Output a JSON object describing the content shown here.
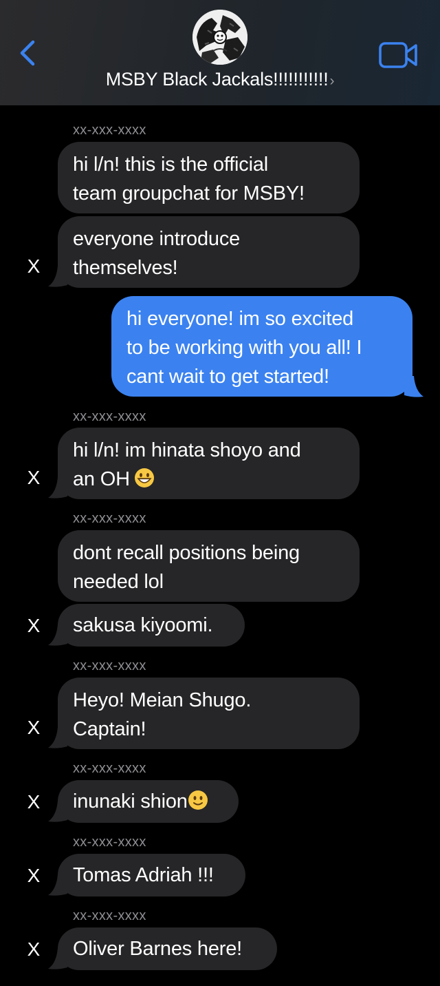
{
  "header": {
    "title": "MSBY Black Jackals!!!!!!!!!!!",
    "chevron": "›",
    "back_icon": "chevron-left-icon",
    "video_icon": "video-camera-icon",
    "accent": "#3b82f0"
  },
  "colors": {
    "incoming_bubble": "#262628",
    "outgoing_bubble": "#3b82f0",
    "sender_text": "#8e8e93",
    "background": "#000000"
  },
  "messages": [
    {
      "sender": "xx-xxx-xxxx",
      "text_lines": [
        "hi l/n! this is the official",
        "team groupchat for MSBY!"
      ]
    },
    {
      "text_lines": [
        "everyone introduce",
        "themselves!"
      ],
      "avatar": "X"
    },
    {
      "outgoing": true,
      "text_lines": [
        "hi everyone! im so excited",
        "to be working with you all! I",
        "cant wait to get started!"
      ]
    },
    {
      "sender": "xx-xxx-xxxx",
      "text_lines": [
        "hi l/n! im hinata shoyo and",
        "an OH"
      ],
      "emoji": "grinning-face-emoji",
      "avatar": "X"
    },
    {
      "sender": "xx-xxx-xxxx",
      "text_lines": [
        "dont recall positions being",
        "needed lol"
      ]
    },
    {
      "text_lines": [
        "sakusa kiyoomi."
      ],
      "avatar": "X"
    },
    {
      "sender": "xx-xxx-xxxx",
      "text_lines": [
        "Heyo! Meian Shugo.",
        "Captain!"
      ],
      "avatar": "X"
    },
    {
      "sender": "xx-xxx-xxxx",
      "text_lines": [
        "inunaki shion"
      ],
      "emoji": "slightly-smiling-face-emoji",
      "avatar": "X"
    },
    {
      "sender": "xx-xxx-xxxx",
      "text_lines": [
        "Tomas Adriah !!!"
      ],
      "avatar": "X"
    },
    {
      "sender": "xx-xxx-xxxx",
      "text_lines": [
        "Oliver Barnes here!"
      ],
      "avatar": "X"
    }
  ]
}
